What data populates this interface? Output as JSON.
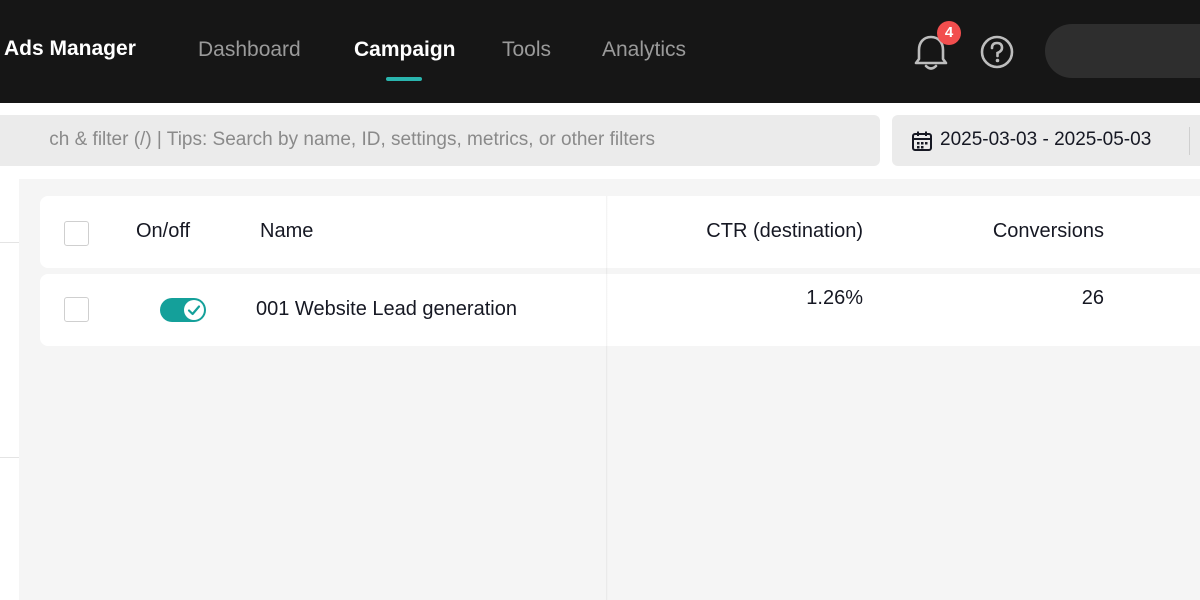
{
  "app": {
    "title": "Ads Manager"
  },
  "nav": {
    "tabs": [
      {
        "label": "Dashboard",
        "active": false
      },
      {
        "label": "Campaign",
        "active": true
      },
      {
        "label": "Tools",
        "active": false
      },
      {
        "label": "Analytics",
        "active": false
      }
    ],
    "accent_color": "#2ab5ae"
  },
  "header_icons": {
    "notifications": {
      "icon": "bell-icon",
      "count": "4",
      "badge_color": "#f24e4e"
    },
    "help": {
      "icon": "help-circle-icon"
    }
  },
  "filter_bar": {
    "search_placeholder": "ch & filter (/) | Tips: Search by name, ID, settings, metrics, or other filters",
    "date_range": "2025-03-03 - 2025-05-03",
    "date_icon": "calendar-icon"
  },
  "table": {
    "columns": [
      "On/off",
      "Name",
      "CTR (destination)",
      "Conversions"
    ],
    "rows": [
      {
        "enabled": true,
        "name": "001 Website Lead generation",
        "ctr_destination": "1.26%",
        "conversions": "26"
      }
    ],
    "toggle_color": "#14a09a"
  }
}
